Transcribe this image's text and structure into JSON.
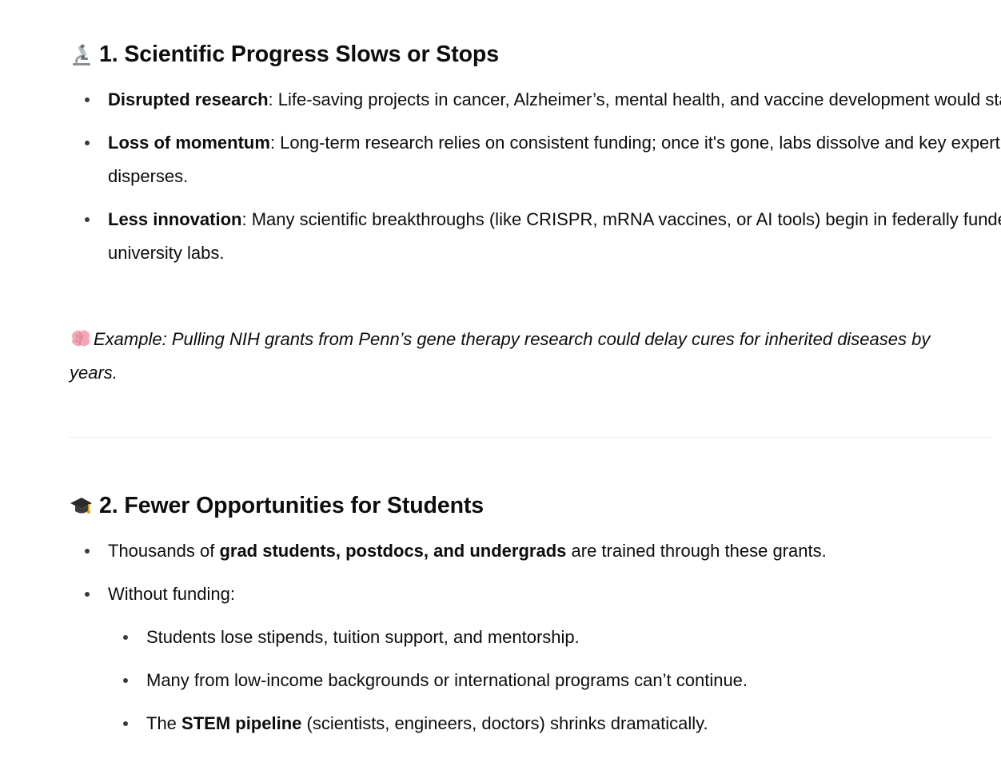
{
  "section1": {
    "heading": "1. Scientific Progress Slows or Stops",
    "icon": "microscope-icon",
    "bullets": [
      {
        "bold": "Disrupted research",
        "text": ": Life-saving projects in cancer, Alzheimer’s, mental health, and vaccine development would stall."
      },
      {
        "bold": "Loss of momentum",
        "text": ": Long-term research relies on consistent funding; once it's gone, labs dissolve and key expertise disperses."
      },
      {
        "bold": "Less innovation",
        "text": ": Many scientific breakthroughs (like CRISPR, mRNA vaccines, or AI tools) begin in federally funded university labs."
      }
    ],
    "example_icon": "brain-icon",
    "example": "Example: Pulling NIH grants from Penn’s gene therapy research could delay cures for inherited diseases by years."
  },
  "section2": {
    "heading": "2. Fewer Opportunities for Students",
    "icon": "graduation-cap-icon",
    "bullet1": {
      "pre": "Thousands of ",
      "bold": "grad students, postdocs, and undergrads",
      "post": " are trained through these grants."
    },
    "bullet2": "Without funding:",
    "sub": [
      "Students lose stipends, tuition support, and mentorship.",
      "Many from low-income backgrounds or international programs can’t continue."
    ],
    "sub3": {
      "pre": "The ",
      "bold": "STEM pipeline",
      "post": " (scientists, engineers, doctors) shrinks dramatically."
    }
  }
}
